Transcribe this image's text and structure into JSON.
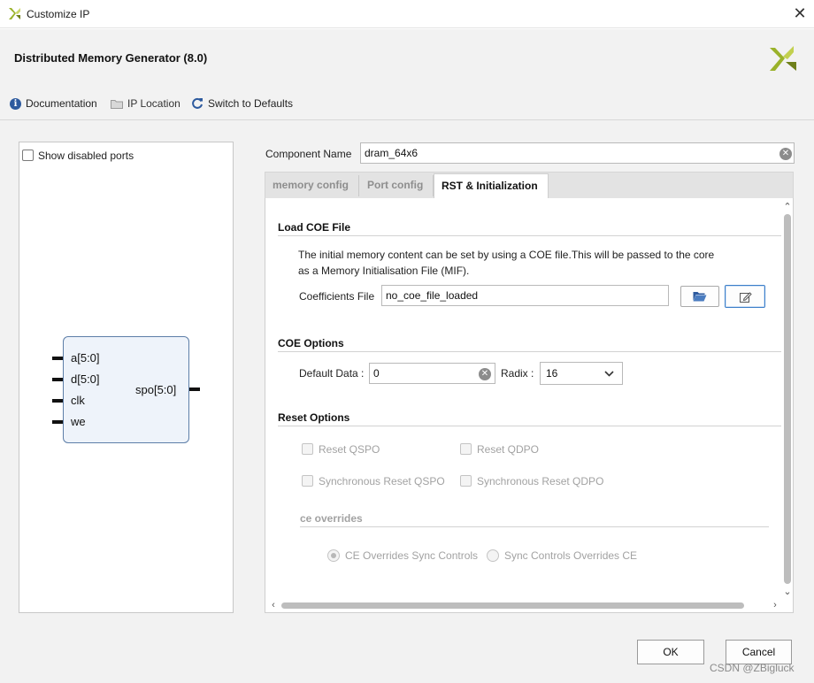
{
  "window": {
    "title": "Customize IP"
  },
  "header": {
    "ip_title": "Distributed Memory Generator (8.0)"
  },
  "toolbar": {
    "documentation": "Documentation",
    "ip_location": "IP Location",
    "switch_defaults": "Switch to Defaults"
  },
  "left_panel": {
    "show_disabled_ports": "Show disabled ports",
    "symbol": {
      "inputs": [
        "a[5:0]",
        "d[5:0]",
        "clk",
        "we"
      ],
      "output": "spo[5:0]"
    }
  },
  "component": {
    "label": "Component Name",
    "value": "dram_64x6"
  },
  "tabs": [
    {
      "label": "memory config",
      "active": false
    },
    {
      "label": "Port config",
      "active": false
    },
    {
      "label": "RST & Initialization",
      "active": true
    }
  ],
  "load_coe": {
    "title": "Load COE File",
    "description_line1": "The initial memory content can be set by using a COE file.This will be passed to the core",
    "description_line2": "as a Memory Initialisation File (MIF).",
    "coef_label": "Coefficients File",
    "coef_value": "no_coe_file_loaded"
  },
  "coe_options": {
    "title": "COE Options",
    "default_data_label": "Default Data :",
    "default_data_value": "0",
    "radix_label": "Radix :",
    "radix_value": "16"
  },
  "reset_options": {
    "title": "Reset Options",
    "reset_qspo": "Reset QSPO",
    "reset_qdpo": "Reset QDPO",
    "sync_reset_qspo": "Synchronous Reset QSPO",
    "sync_reset_qdpo": "Synchronous Reset QDPO",
    "ce_title": "ce overrides",
    "ce_overrides_sync": "CE Overrides Sync Controls",
    "sync_overrides_ce": "Sync Controls Overrides CE"
  },
  "footer": {
    "ok": "OK",
    "cancel": "Cancel",
    "watermark": "CSDN @ZBigluck"
  },
  "colors": {
    "logo_green": "#9ab22a",
    "logo_dark": "#6e7f1a",
    "accent_blue": "#3c7fc9",
    "folder_blue": "#2d5a9e"
  }
}
